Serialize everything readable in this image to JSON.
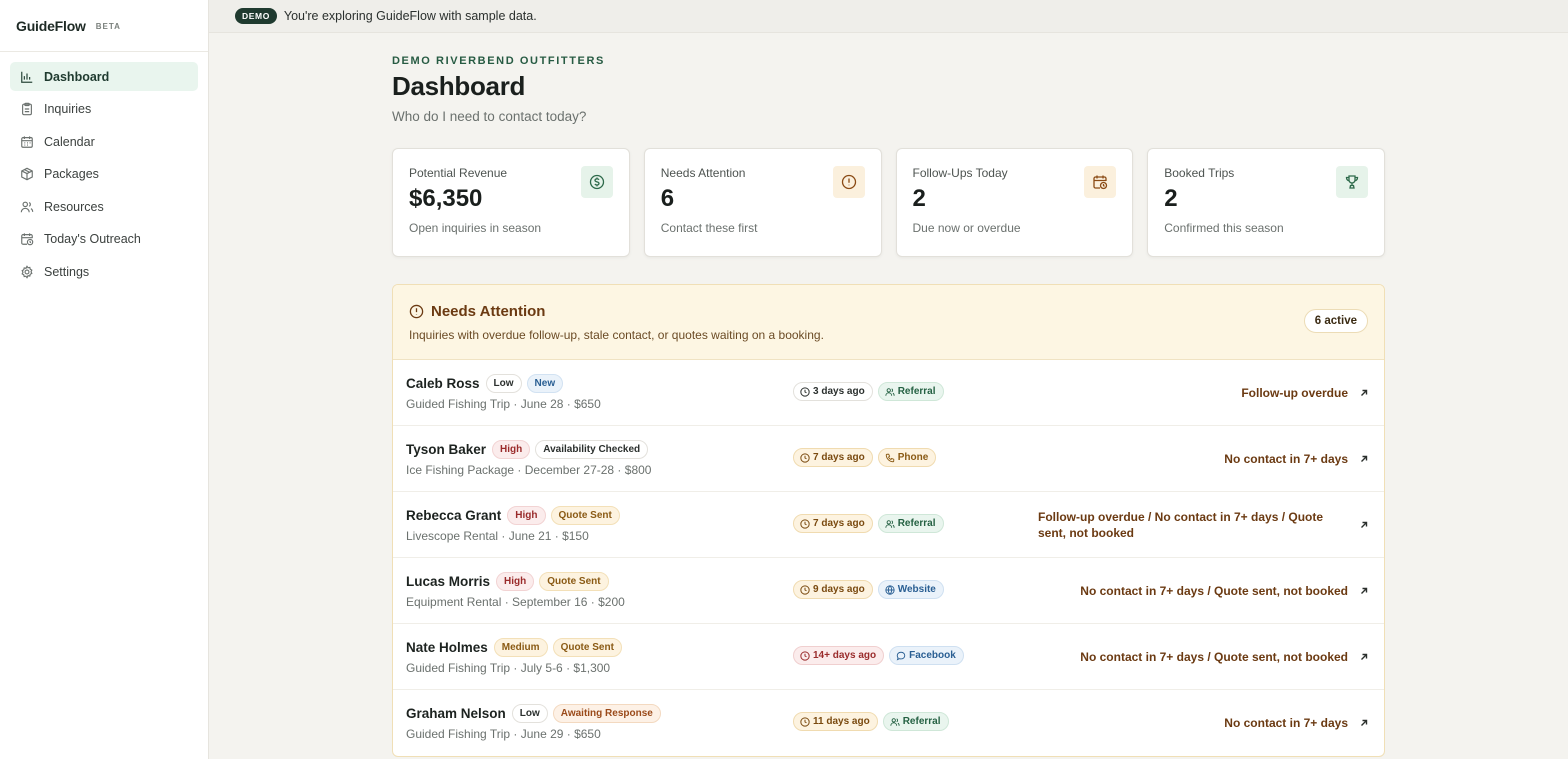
{
  "brand": {
    "name": "GuideFlow",
    "badge": "BETA"
  },
  "nav": [
    {
      "label": "Dashboard",
      "icon": "bar-chart-icon",
      "active": true
    },
    {
      "label": "Inquiries",
      "icon": "clipboard-icon"
    },
    {
      "label": "Calendar",
      "icon": "calendar-icon"
    },
    {
      "label": "Packages",
      "icon": "package-icon"
    },
    {
      "label": "Resources",
      "icon": "users-icon"
    },
    {
      "label": "Today's Outreach",
      "icon": "calendar-clock-icon"
    },
    {
      "label": "Settings",
      "icon": "gear-icon"
    }
  ],
  "banner": {
    "pill": "DEMO",
    "text": "You're exploring GuideFlow with sample data."
  },
  "header": {
    "org": "DEMO RIVERBEND OUTFITTERS",
    "title": "Dashboard",
    "subtitle": "Who do I need to contact today?"
  },
  "cards": [
    {
      "label": "Potential Revenue",
      "value": "$6,350",
      "note": "Open inquiries in season",
      "icon": "dollar-icon"
    },
    {
      "label": "Needs Attention",
      "value": "6",
      "note": "Contact these first",
      "icon": "alert-icon"
    },
    {
      "label": "Follow-Ups Today",
      "value": "2",
      "note": "Due now or overdue",
      "icon": "calendar-clock-icon"
    },
    {
      "label": "Booked Trips",
      "value": "2",
      "note": "Confirmed this season",
      "icon": "trophy-icon"
    }
  ],
  "attention": {
    "title": "Needs Attention",
    "description": "Inquiries with overdue follow-up, stale contact, or quotes waiting on a booking.",
    "count_label": "6 active",
    "rows": [
      {
        "name": "Caleb Ross",
        "priority": "Low",
        "status": "New",
        "detail": "Guided Fishing Trip · June 28 · $650",
        "age": "3 days ago",
        "source": "Referral",
        "reason": "Follow-up overdue"
      },
      {
        "name": "Tyson Baker",
        "priority": "High",
        "status": "Availability Checked",
        "detail": "Ice Fishing Package · December 27-28 · $800",
        "age": "7 days ago",
        "source": "Phone",
        "reason": "No contact in 7+ days"
      },
      {
        "name": "Rebecca Grant",
        "priority": "High",
        "status": "Quote Sent",
        "detail": "Livescope Rental · June 21 · $150",
        "age": "7 days ago",
        "source": "Referral",
        "reason": "Follow-up overdue / No contact in 7+ days / Quote sent, not booked"
      },
      {
        "name": "Lucas Morris",
        "priority": "High",
        "status": "Quote Sent",
        "detail": "Equipment Rental · September 16 · $200",
        "age": "9 days ago",
        "source": "Website",
        "reason": "No contact in 7+ days / Quote sent, not booked"
      },
      {
        "name": "Nate Holmes",
        "priority": "Medium",
        "status": "Quote Sent",
        "detail": "Guided Fishing Trip · July 5-6 · $1,300",
        "age": "14+ days ago",
        "source": "Facebook",
        "reason": "No contact in 7+ days / Quote sent, not booked"
      },
      {
        "name": "Graham Nelson",
        "priority": "Low",
        "status": "Awaiting Response",
        "detail": "Guided Fishing Trip · June 29 · $650",
        "age": "11 days ago",
        "source": "Referral",
        "reason": "No contact in 7+ days"
      }
    ]
  }
}
